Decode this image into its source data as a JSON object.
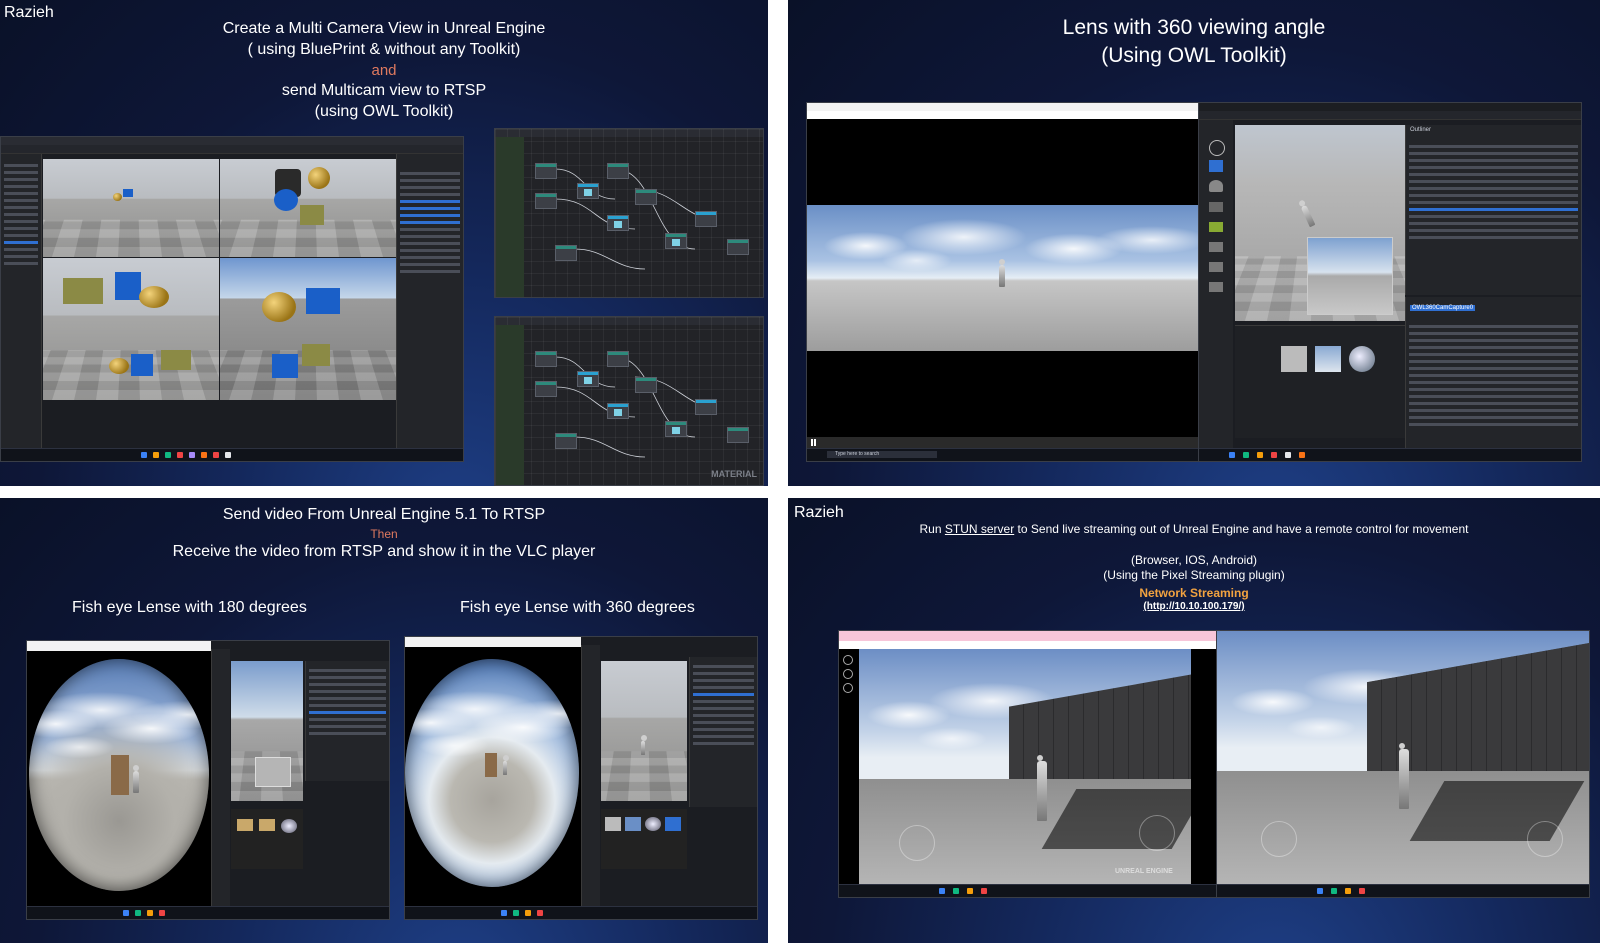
{
  "panels": {
    "multicam": {
      "author": "Razieh",
      "title_line1": "Create a  Multi Camera  View in Unreal Engine",
      "title_line2": "( using BluePrint & without any Toolkit)",
      "connector": "and",
      "title_line3": "send Multicam view to RTSP",
      "title_line4": "(using OWL Toolkit)",
      "graph_watermark": "MATERIAL"
    },
    "lens360": {
      "title_line1": "Lens with 360 viewing angle",
      "title_line2": "(Using OWL Toolkit)",
      "search_placeholder": "Type here to search",
      "outliner_label": "Outliner",
      "selected_item": "OWL360CamCapture0"
    },
    "rtsp": {
      "title_line1": "Send video From Unreal Engine 5.1 To RTSP",
      "connector": "Then",
      "title_line2": "Receive the video from RTSP and show it in the VLC player",
      "caption_180": "Fish eye Lense with 180 degrees",
      "caption_360": "Fish eye Lense with 360 degrees"
    },
    "streaming": {
      "author": "Razieh",
      "line1_prefix": "Run ",
      "line1_link": "STUN server",
      "line1_suffix": " to Send live streaming out of Unreal Engine and have a remote control for movement",
      "line2": "(Browser, IOS, Android)",
      "line3": "(Using the Pixel Streaming plugin)",
      "highlight": "Network Streaming",
      "url": "(http://10.10.100.179/)",
      "engine_watermark": "UNREAL ENGINE"
    }
  },
  "colors": {
    "accent": "#e07a5f",
    "highlight": "#f2a340",
    "selection": "#2f6fd1",
    "panel_bg": "#0e1738"
  }
}
